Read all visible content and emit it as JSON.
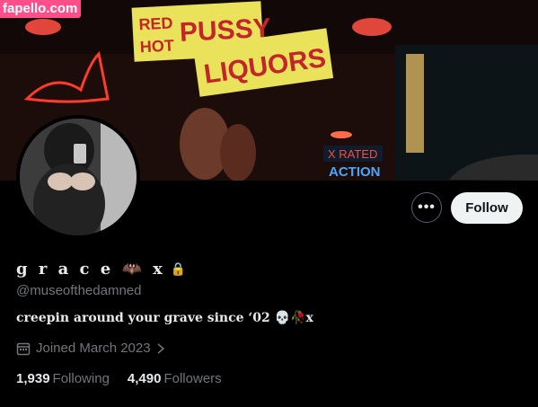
{
  "watermark": "fapello.com",
  "banner": {
    "sign_top": "RED PUSSY",
    "sign_hot": "HOT",
    "sign_liquors": "LIQUORS",
    "sign_x_rated": "X RATED",
    "sign_action": "ACTION"
  },
  "profile": {
    "display_name": "g r a c e 🦇 x",
    "lock_icon": "🔒",
    "handle": "@museofthedamned",
    "bio": "creepin around your grave since ‘02 💀🥀x",
    "joined": "Joined March 2023",
    "following_count": "1,939",
    "following_label": "Following",
    "followers_count": "4,490",
    "followers_label": "Followers"
  },
  "actions": {
    "more_label": "•••",
    "follow_label": "Follow"
  },
  "colors": {
    "follow_bg": "#eff3f4",
    "muted_text": "#71767b",
    "watermark_bg": "#ff4f8b"
  }
}
